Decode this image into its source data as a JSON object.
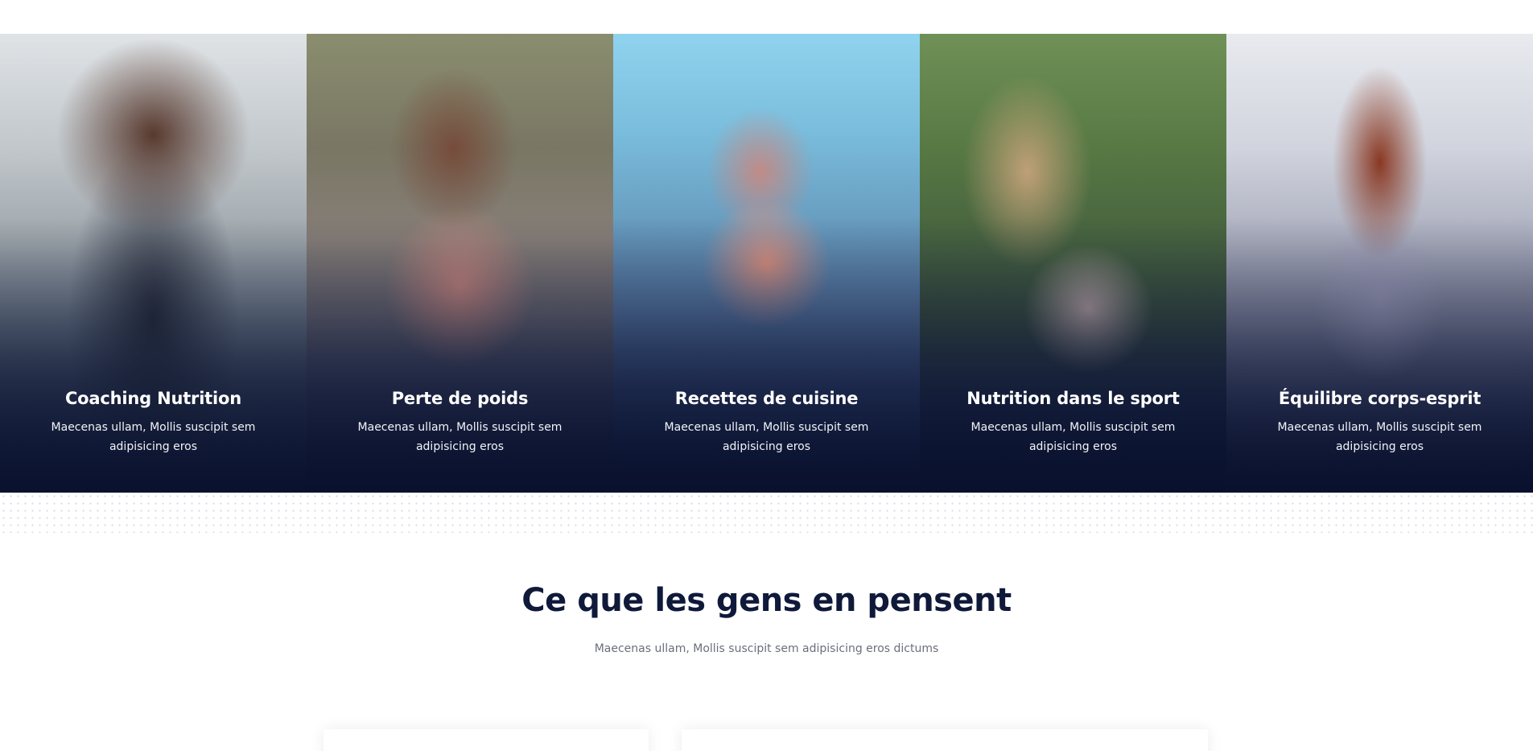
{
  "services": [
    {
      "title": "Coaching Nutrition",
      "description": "Maecenas ullam, Mollis suscipit sem adipisicing eros"
    },
    {
      "title": "Perte de poids",
      "description": "Maecenas ullam, Mollis suscipit sem adipisicing eros"
    },
    {
      "title": "Recettes de cuisine",
      "description": "Maecenas ullam, Mollis suscipit sem adipisicing eros"
    },
    {
      "title": "Nutrition dans le sport",
      "description": "Maecenas ullam, Mollis suscipit sem adipisicing eros"
    },
    {
      "title": "Équilibre corps-esprit",
      "description": "Maecenas ullam, Mollis suscipit sem adipisicing eros"
    }
  ],
  "testimonials": {
    "title": "Ce que les gens en pensent",
    "subtitle": "Maecenas ullam, Mollis suscipit sem adipisicing eros dictums"
  },
  "colors": {
    "heading": "#0f1a3a",
    "overlay_dark": "#08102d",
    "subtitle": "#6b6f7b"
  }
}
